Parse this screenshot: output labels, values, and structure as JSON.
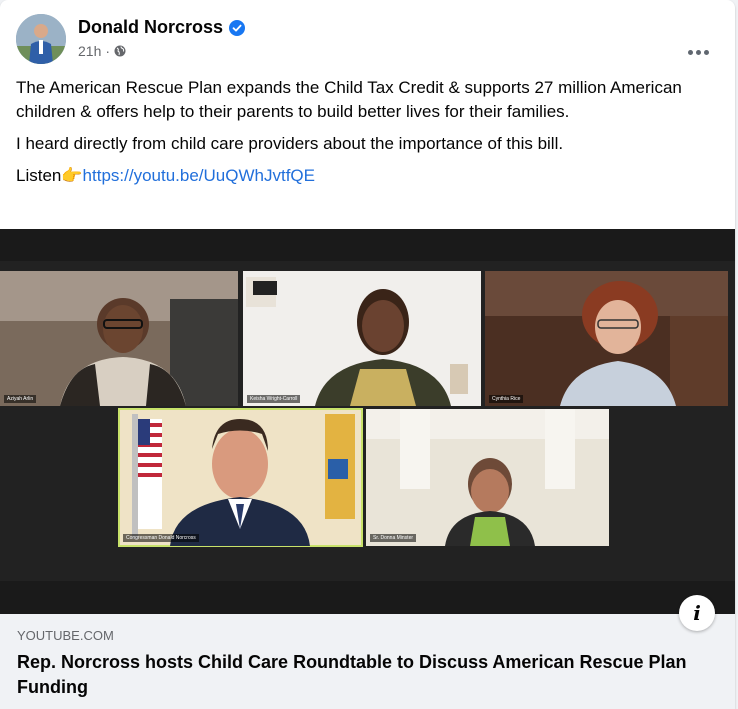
{
  "post": {
    "author": "Donald Norcross",
    "time": "21h",
    "separator": "·",
    "paragraph1": "The American Rescue Plan expands the Child Tax Credit & supports 27 million American children & offers help to their parents to build better lives for their families.",
    "paragraph2": "I heard directly from child care providers about the importance of this bill.",
    "listen": "Listen",
    "pointing_emoji": "👉",
    "link_url": "https://youtu.be/UuQWhJvtfQE"
  },
  "video": {
    "participants": [
      {
        "name": "Aziyah Arlin"
      },
      {
        "name": "Keisha Wright-Carroll"
      },
      {
        "name": "Cynthia Rice"
      },
      {
        "name": "Congressman Donald Norcross"
      },
      {
        "name": "Sr. Donna Minster"
      }
    ]
  },
  "preview": {
    "domain": "YOUTUBE.COM",
    "title": "Rep. Norcross hosts Child Care Roundtable to Discuss American Rescue Plan Funding"
  },
  "colors": {
    "link": "#216fdb",
    "verified": "#1877f2",
    "active_speaker_border": "#c8e26a"
  },
  "icons": [
    "verified-badge-icon",
    "globe-icon",
    "more-options-icon",
    "info-icon"
  ]
}
